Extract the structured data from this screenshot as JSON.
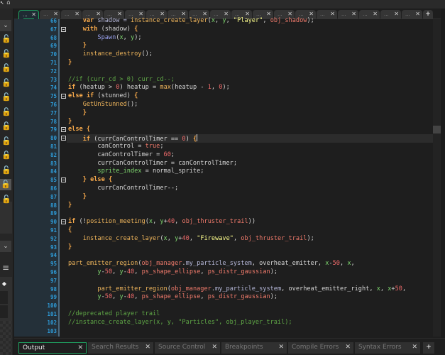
{
  "top_icons": [
    {
      "name": "arrow-icon",
      "glyph": "↖"
    },
    {
      "name": "basket-icon",
      "glyph": "⌂"
    }
  ],
  "sidebar": {
    "collapse_glyph": "⌄",
    "lock_glyph": "🔓",
    "lock_count": 12,
    "active_lock_index": 10,
    "menu_glyph": "≡",
    "tag_glyph": "◆"
  },
  "editor_tabs": {
    "tab_label": "...",
    "close_glyph": "✕",
    "count": 19,
    "active_index": 0,
    "add_glyph": "+"
  },
  "editor": {
    "current_line": 80,
    "fold_lines": [
      67,
      75,
      79,
      80,
      85,
      90
    ],
    "lines": [
      {
        "n": 66,
        "tokens": [
          [
            "    ",
            ""
          ],
          [
            "var",
            "kw"
          ],
          [
            " shadow = ",
            "var"
          ],
          [
            "instance_create_layer",
            "fn"
          ],
          [
            "(",
            ""
          ],
          [
            "x",
            "loc"
          ],
          [
            ", ",
            ""
          ],
          [
            "y",
            "loc"
          ],
          [
            ", ",
            ""
          ],
          [
            "\"Player\"",
            "str"
          ],
          [
            ", ",
            ""
          ],
          [
            "obj_shadow",
            "res"
          ],
          [
            ");",
            ""
          ]
        ]
      },
      {
        "n": 67,
        "tokens": [
          [
            "    ",
            ""
          ],
          [
            "with",
            "kw"
          ],
          [
            " (shadow) ",
            ""
          ],
          [
            "{",
            "kw"
          ]
        ]
      },
      {
        "n": 68,
        "tokens": [
          [
            "        ",
            ""
          ],
          [
            "Spawn",
            "sc"
          ],
          [
            "(",
            ""
          ],
          [
            "x",
            "loc"
          ],
          [
            ", ",
            ""
          ],
          [
            "y",
            "loc"
          ],
          [
            ");",
            ""
          ]
        ]
      },
      {
        "n": 69,
        "tokens": [
          [
            "    ",
            ""
          ],
          [
            "}",
            "kw"
          ]
        ]
      },
      {
        "n": 70,
        "tokens": [
          [
            "    ",
            ""
          ],
          [
            "instance_destroy",
            "fn"
          ],
          [
            "();",
            ""
          ]
        ]
      },
      {
        "n": 71,
        "tokens": [
          [
            "}",
            "kw"
          ]
        ]
      },
      {
        "n": 72,
        "tokens": []
      },
      {
        "n": 73,
        "tokens": [
          [
            "//if (curr_cd > 0) curr_cd--;",
            "cm"
          ]
        ]
      },
      {
        "n": 74,
        "tokens": [
          [
            "if",
            "kw"
          ],
          [
            " (heatup > ",
            ""
          ],
          [
            "0",
            "num"
          ],
          [
            ") heatup = ",
            ""
          ],
          [
            "max",
            "fn"
          ],
          [
            "(heatup - ",
            ""
          ],
          [
            "1",
            "num"
          ],
          [
            ", ",
            ""
          ],
          [
            "0",
            "num"
          ],
          [
            ");",
            ""
          ]
        ]
      },
      {
        "n": 75,
        "tokens": [
          [
            "else if",
            "kw"
          ],
          [
            " (stunned) ",
            ""
          ],
          [
            "{",
            "kw"
          ]
        ]
      },
      {
        "n": 76,
        "tokens": [
          [
            "    ",
            ""
          ],
          [
            "GetUnStunned",
            "fn"
          ],
          [
            "();",
            ""
          ]
        ]
      },
      {
        "n": 77,
        "tokens": [
          [
            "    ",
            ""
          ],
          [
            "}",
            "kw"
          ]
        ]
      },
      {
        "n": 78,
        "tokens": [
          [
            "}",
            "kw"
          ]
        ]
      },
      {
        "n": 79,
        "tokens": [
          [
            "else",
            "kw"
          ],
          [
            " ",
            ""
          ],
          [
            "{",
            "kw"
          ]
        ]
      },
      {
        "n": 80,
        "tokens": [
          [
            "    ",
            ""
          ],
          [
            "if",
            "kw"
          ],
          [
            " (currCanControlTimer == ",
            ""
          ],
          [
            "0",
            "num"
          ],
          [
            ") ",
            ""
          ],
          [
            "{",
            "kw"
          ]
        ]
      },
      {
        "n": 81,
        "tokens": [
          [
            "        canControl = ",
            ""
          ],
          [
            "true",
            "res"
          ],
          [
            ";",
            ""
          ]
        ]
      },
      {
        "n": 82,
        "tokens": [
          [
            "        canControlTimer = ",
            ""
          ],
          [
            "60",
            "num"
          ],
          [
            ";",
            ""
          ]
        ]
      },
      {
        "n": 83,
        "tokens": [
          [
            "        currCanControlTimer = canControlTimer;",
            ""
          ]
        ]
      },
      {
        "n": 84,
        "tokens": [
          [
            "        ",
            ""
          ],
          [
            "sprite_index",
            "bi"
          ],
          [
            " = normal_sprite;",
            ""
          ]
        ]
      },
      {
        "n": 85,
        "tokens": [
          [
            "    ",
            ""
          ],
          [
            "}",
            "kw"
          ],
          [
            " ",
            ""
          ],
          [
            "else",
            "kw"
          ],
          [
            " ",
            ""
          ],
          [
            "{",
            "kw"
          ]
        ]
      },
      {
        "n": 86,
        "tokens": [
          [
            "        currCanControlTimer--;",
            ""
          ]
        ]
      },
      {
        "n": 87,
        "tokens": [
          [
            "    ",
            ""
          ],
          [
            "}",
            "kw"
          ]
        ]
      },
      {
        "n": 88,
        "tokens": [
          [
            "}",
            "kw"
          ]
        ]
      },
      {
        "n": 89,
        "tokens": []
      },
      {
        "n": 90,
        "tokens": [
          [
            "if",
            "kw"
          ],
          [
            " (!",
            ""
          ],
          [
            "position_meeting",
            "fn"
          ],
          [
            "(",
            ""
          ],
          [
            "x",
            "loc"
          ],
          [
            ", ",
            ""
          ],
          [
            "y",
            "loc"
          ],
          [
            "+",
            ""
          ],
          [
            "40",
            "num"
          ],
          [
            ", ",
            ""
          ],
          [
            "obj_thruster_trail",
            "res"
          ],
          [
            "))",
            ""
          ]
        ]
      },
      {
        "n": 91,
        "tokens": [
          [
            "{",
            "kw"
          ]
        ]
      },
      {
        "n": 92,
        "tokens": [
          [
            "    ",
            ""
          ],
          [
            "instance_create_layer",
            "fn"
          ],
          [
            "(",
            ""
          ],
          [
            "x",
            "loc"
          ],
          [
            ", ",
            ""
          ],
          [
            "y",
            "loc"
          ],
          [
            "+",
            ""
          ],
          [
            "40",
            "num"
          ],
          [
            ", ",
            ""
          ],
          [
            "\"Firewave\"",
            "str"
          ],
          [
            ", ",
            ""
          ],
          [
            "obj_thruster_trail",
            "res"
          ],
          [
            ");",
            ""
          ]
        ]
      },
      {
        "n": 93,
        "tokens": [
          [
            "}",
            "kw"
          ]
        ]
      },
      {
        "n": 94,
        "tokens": []
      },
      {
        "n": 95,
        "tokens": [
          [
            "part_emitter_region",
            "fn"
          ],
          [
            "(",
            ""
          ],
          [
            "obj_manager",
            "res"
          ],
          [
            ".",
            ""
          ],
          [
            "my_particle_system",
            "var"
          ],
          [
            ", overheat_emitter, ",
            ""
          ],
          [
            "x",
            "loc"
          ],
          [
            "-",
            ""
          ],
          [
            "50",
            "num"
          ],
          [
            ", ",
            ""
          ],
          [
            "x",
            "loc"
          ],
          [
            ",",
            ""
          ]
        ]
      },
      {
        "n": 96,
        "tokens": [
          [
            "        ",
            ""
          ],
          [
            "y",
            "loc"
          ],
          [
            "-",
            ""
          ],
          [
            "50",
            "num"
          ],
          [
            ", ",
            ""
          ],
          [
            "y",
            "loc"
          ],
          [
            "-",
            ""
          ],
          [
            "40",
            "num"
          ],
          [
            ", ",
            ""
          ],
          [
            "ps_shape_ellipse",
            "res"
          ],
          [
            ", ",
            ""
          ],
          [
            "ps_distr_gaussian",
            "res"
          ],
          [
            ");",
            ""
          ]
        ]
      },
      {
        "n": 97,
        "tokens": []
      },
      {
        "n": 98,
        "tokens": [
          [
            "        ",
            ""
          ],
          [
            "part_emitter_region",
            "fn"
          ],
          [
            "(",
            ""
          ],
          [
            "obj_manager",
            "res"
          ],
          [
            ".",
            ""
          ],
          [
            "my_particle_system",
            "var"
          ],
          [
            ", overheat_emitter_right, ",
            ""
          ],
          [
            "x",
            "loc"
          ],
          [
            ", ",
            ""
          ],
          [
            "x",
            "loc"
          ],
          [
            "+",
            ""
          ],
          [
            "50",
            "num"
          ],
          [
            ",",
            ""
          ]
        ]
      },
      {
        "n": 99,
        "tokens": [
          [
            "        ",
            ""
          ],
          [
            "y",
            "loc"
          ],
          [
            "-",
            ""
          ],
          [
            "50",
            "num"
          ],
          [
            ", ",
            ""
          ],
          [
            "y",
            "loc"
          ],
          [
            "-",
            ""
          ],
          [
            "40",
            "num"
          ],
          [
            ", ",
            ""
          ],
          [
            "ps_shape_ellipse",
            "res"
          ],
          [
            ", ",
            ""
          ],
          [
            "ps_distr_gaussian",
            "res"
          ],
          [
            ");",
            ""
          ]
        ]
      },
      {
        "n": 100,
        "tokens": []
      },
      {
        "n": 101,
        "tokens": [
          [
            "//deprecated player trail",
            "cm"
          ]
        ]
      },
      {
        "n": 102,
        "tokens": [
          [
            "//instance_create_layer(x, y, \"Particles\", obj_player_trail);",
            "cm"
          ]
        ]
      },
      {
        "n": 103,
        "tokens": []
      }
    ]
  },
  "bottom_tabs": {
    "tabs": [
      {
        "label": "Output",
        "active": true
      },
      {
        "label": "Search Results",
        "active": false
      },
      {
        "label": "Source Control",
        "active": false
      },
      {
        "label": "Breakpoints",
        "active": false
      },
      {
        "label": "Compile Errors",
        "active": false
      },
      {
        "label": "Syntax Errors",
        "active": false
      }
    ],
    "close_glyph": "✕",
    "add_glyph": "+"
  },
  "colors": {
    "accent": "#1fa060",
    "line_number": "#2e9ad6",
    "gutter_bg": "#243039",
    "editor_bg": "#1e1e1e"
  }
}
